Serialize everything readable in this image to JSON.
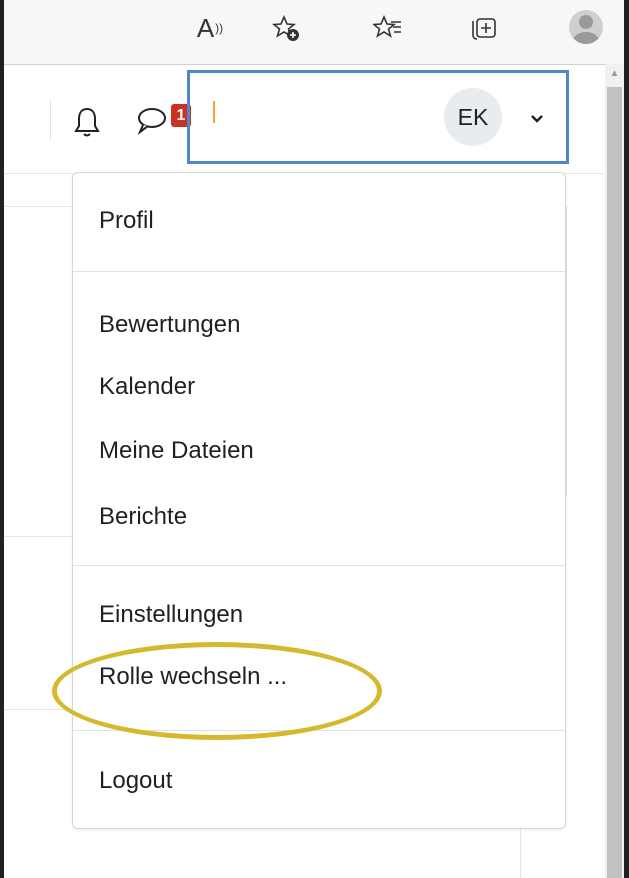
{
  "navbar": {
    "notification_count": "1",
    "user_initials": "EK"
  },
  "user_menu": {
    "items": [
      {
        "label": "Profil"
      },
      {
        "label": "Bewertungen"
      },
      {
        "label": "Kalender"
      },
      {
        "label": "Meine Dateien"
      },
      {
        "label": "Berichte"
      },
      {
        "label": "Einstellungen"
      },
      {
        "label": "Rolle wechseln ..."
      },
      {
        "label": "Logout"
      }
    ]
  },
  "annotation": {
    "highlight_color": "#d4b92e"
  },
  "colors": {
    "focus_border": "#4f86c6",
    "badge": "#ca3120"
  },
  "icons": [
    "read-aloud-icon",
    "add-favorite-icon",
    "favorites-icon",
    "collections-icon",
    "profile-avatar-icon",
    "bell-icon",
    "chat-icon",
    "chevron-down-icon"
  ]
}
